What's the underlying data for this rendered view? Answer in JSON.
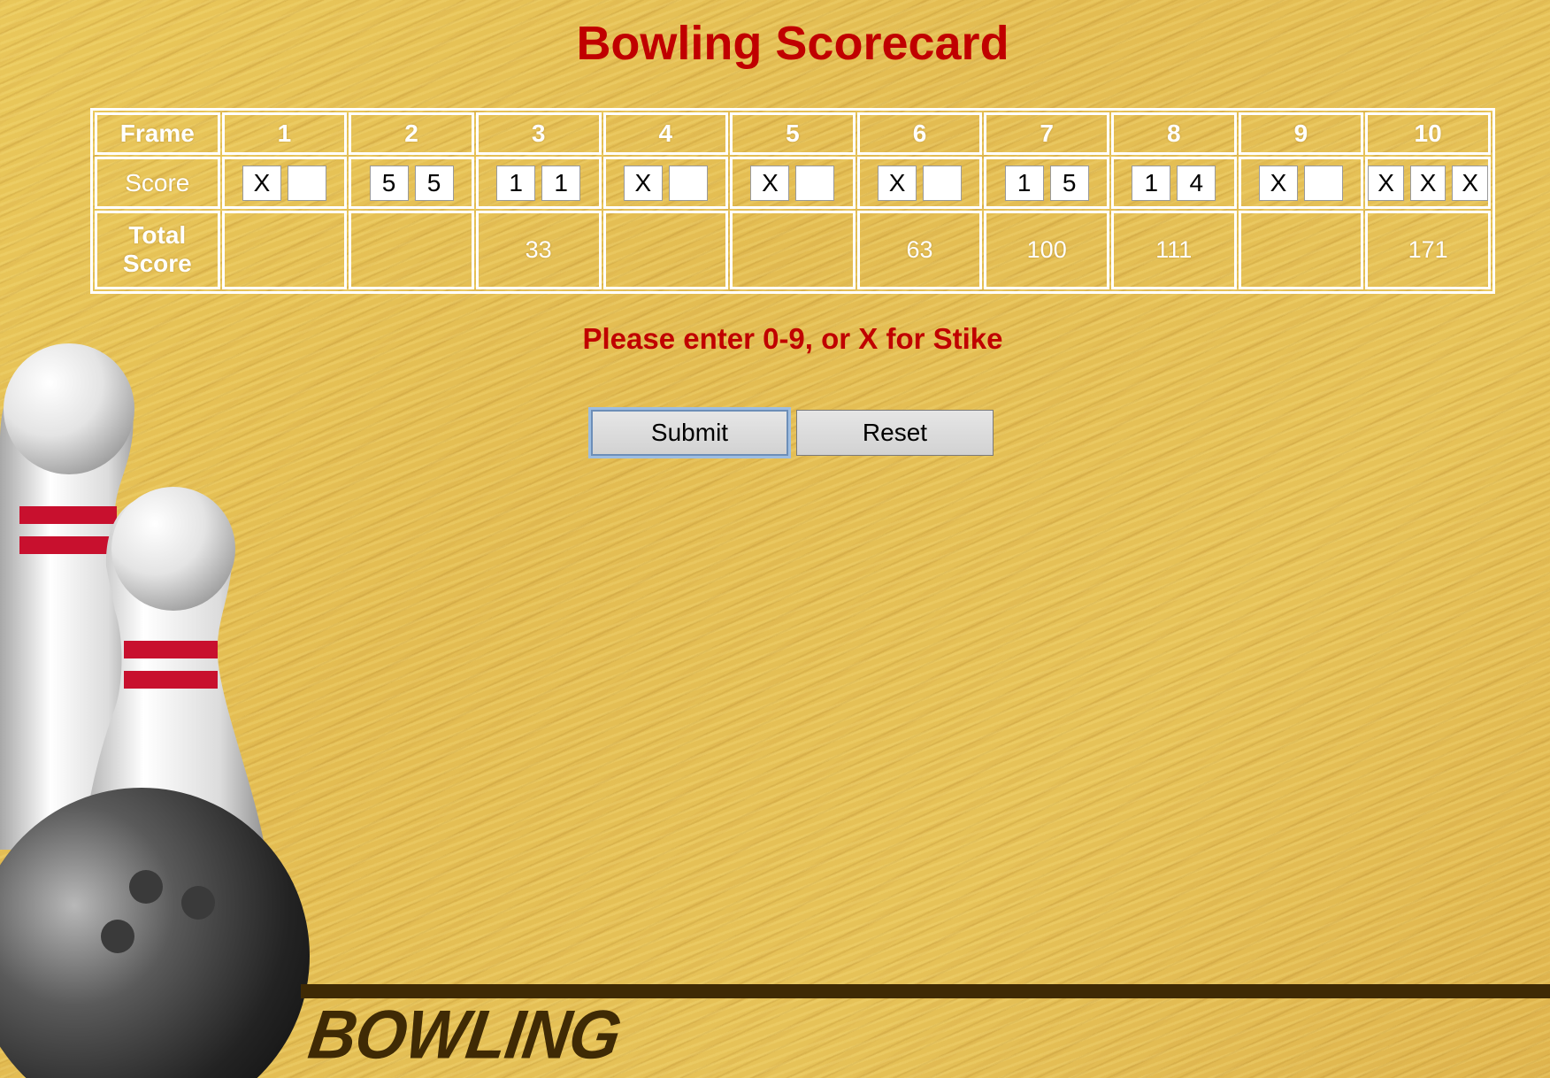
{
  "title": "Bowling Scorecard",
  "table": {
    "header_label": "Frame",
    "score_label": "Score",
    "total_label": "Total Score",
    "frames": [
      {
        "number": "1",
        "rolls": [
          "X",
          ""
        ],
        "total": ""
      },
      {
        "number": "2",
        "rolls": [
          "5",
          "5"
        ],
        "total": ""
      },
      {
        "number": "3",
        "rolls": [
          "1",
          "1"
        ],
        "total": "33"
      },
      {
        "number": "4",
        "rolls": [
          "X",
          ""
        ],
        "total": ""
      },
      {
        "number": "5",
        "rolls": [
          "X",
          ""
        ],
        "total": ""
      },
      {
        "number": "6",
        "rolls": [
          "X",
          ""
        ],
        "total": "63"
      },
      {
        "number": "7",
        "rolls": [
          "1",
          "5"
        ],
        "total": "100"
      },
      {
        "number": "8",
        "rolls": [
          "1",
          "4"
        ],
        "total": "111"
      },
      {
        "number": "9",
        "rolls": [
          "X",
          ""
        ],
        "total": ""
      },
      {
        "number": "10",
        "rolls": [
          "X",
          "X",
          "X"
        ],
        "total": "171"
      }
    ]
  },
  "message": "Please enter 0-9, or X for Stike",
  "buttons": {
    "submit": "Submit",
    "reset": "Reset"
  },
  "logo": "BOWLING",
  "colors": {
    "accent": "#c00000",
    "background": "#e8c456",
    "logo": "#3f2a05"
  }
}
